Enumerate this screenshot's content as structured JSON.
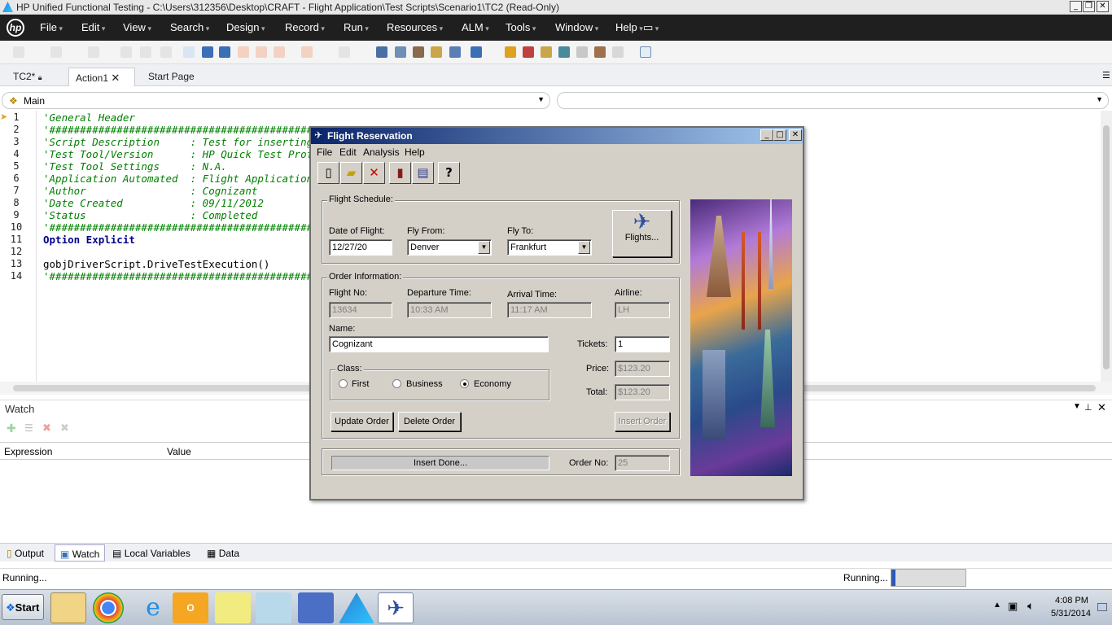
{
  "window": {
    "title": "HP Unified Functional Testing - C:\\Users\\312356\\Desktop\\CRAFT - Flight Application\\Test Scripts\\Scenario1\\TC2 (Read-Only)"
  },
  "menu": [
    "File",
    "Edit",
    "View",
    "Search",
    "Design",
    "Record",
    "Run",
    "Resources",
    "ALM",
    "Tools",
    "Window",
    "Help"
  ],
  "doc_tabs": [
    "TC2*",
    "Action1",
    "Start Page"
  ],
  "selector": {
    "left": "Main",
    "right": ""
  },
  "code": {
    "line_numbers": [
      "1",
      "2",
      "3",
      "4",
      "5",
      "6",
      "7",
      "8",
      "9",
      "10",
      "11",
      "12",
      "13",
      "14"
    ],
    "lines": [
      "'General Header",
      "'#################################################",
      "'Script Description     : Test for inserting a",
      "'Test Tool/Version      : HP Quick Test Profes",
      "'Test Tool Settings     : N.A.",
      "'Application Automated  : Flight Application",
      "'Author                 : Cognizant",
      "'Date Created           : 09/11/2012",
      "'Status                 : Completed",
      "'#################################################",
      "Option Explicit",
      "",
      "gobjDriverScript.DriveTestExecution()",
      "'#################################################"
    ]
  },
  "watch": {
    "title": "Watch",
    "col_expression": "Expression",
    "col_value": "Value"
  },
  "bottom_tabs": [
    "Output",
    "Watch",
    "Local Variables",
    "Data"
  ],
  "status": {
    "left": "Running...",
    "right": "Running..."
  },
  "clock": {
    "time": "4:08 PM",
    "date": "5/31/2014"
  },
  "taskbar": {
    "start": "Start"
  },
  "flight": {
    "title": "Flight Reservation",
    "menu": [
      "File",
      "Edit",
      "Analysis",
      "Help"
    ],
    "schedule_label": "Flight Schedule:",
    "date_label": "Date of Flight:",
    "date_value": "12/27/20",
    "from_label": "Fly From:",
    "from_value": "Denver",
    "to_label": "Fly To:",
    "to_value": "Frankfurt",
    "flights_button": "Flights...",
    "order_label": "Order Information:",
    "flightno_label": "Flight No:",
    "flightno_value": "13634",
    "dep_label": "Departure Time:",
    "dep_value": "10:33 AM",
    "arr_label": "Arrival Time:",
    "arr_value": "11:17 AM",
    "airline_label": "Airline:",
    "airline_value": "LH",
    "name_label": "Name:",
    "name_value": "Cognizant",
    "tickets_label": "Tickets:",
    "tickets_value": "1",
    "class_label": "Class:",
    "class_first": "First",
    "class_business": "Business",
    "class_economy": "Economy",
    "price_label": "Price:",
    "price_value": "$123.20",
    "total_label": "Total:",
    "total_value": "$123.20",
    "update_button": "Update Order",
    "delete_button": "Delete Order",
    "insert_button": "Insert Order",
    "status_text": "Insert Done...",
    "orderno_label": "Order No:",
    "orderno_value": "25"
  }
}
